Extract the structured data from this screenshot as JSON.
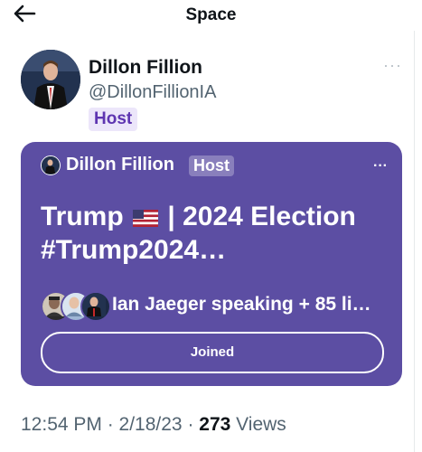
{
  "header": {
    "title": "Space",
    "back_icon": "arrow-left-icon"
  },
  "host": {
    "name": "Dillon Fillion",
    "handle": "@DillonFillionIA",
    "badge": "Host",
    "more": "···"
  },
  "space_card": {
    "host_name": "Dillon Fillion",
    "host_badge": "Host",
    "more": "···",
    "title_part1": "Trump",
    "title_part2": "| 2024 Election #Trump2024…",
    "speaking_text": "Ian Jaeger speaking + 85 li…",
    "joined_label": "Joined",
    "colors": {
      "card_bg": "#5c4ea3",
      "text": "#ffffff"
    }
  },
  "meta": {
    "time_date": "12:54 PM · 2/18/23 · ",
    "views_count": "273",
    "views_label": " Views"
  }
}
